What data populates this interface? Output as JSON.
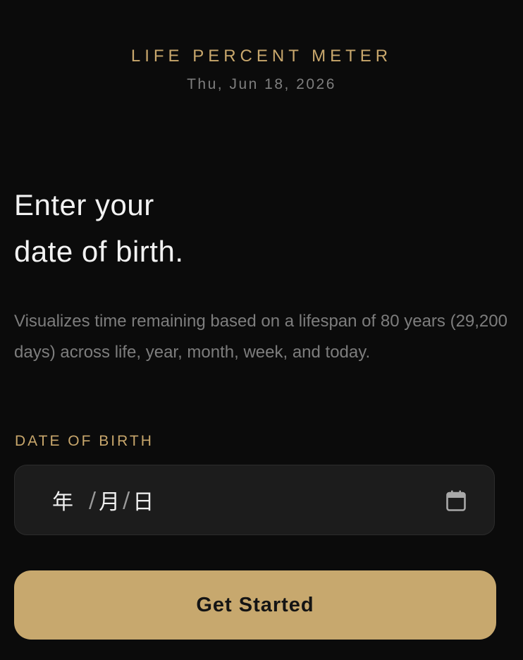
{
  "header": {
    "brand": "LIFE PERCENT METER",
    "current_date": "Thu, Jun 18, 2026"
  },
  "intro": {
    "headline_line1": "Enter your",
    "headline_line2": "date of birth.",
    "description": "Visualizes time remaining based on a lifespan of 80 years (29,200 days) across life, year, month, week, and today."
  },
  "form": {
    "dob_label": "DATE OF BIRTH",
    "dob_input": {
      "year_placeholder": "年",
      "month_placeholder": "月",
      "day_placeholder": "日",
      "separator": "/",
      "icon": "calendar-icon"
    },
    "submit_label": "Get Started"
  },
  "colors": {
    "background": "#0b0b0b",
    "accent": "#c8a76c",
    "button": "#c7a86e",
    "muted_text": "#7d7d7d",
    "input_bg": "#1c1c1c"
  }
}
